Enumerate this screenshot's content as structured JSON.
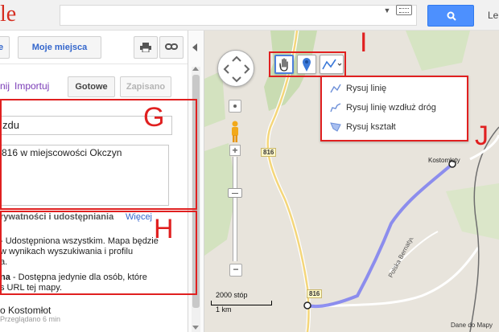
{
  "header": {
    "logo_fragment": "le",
    "search_value": "",
    "user_fragment": "Le"
  },
  "panel": {
    "toolbar": {
      "left_fragment": "e",
      "my_places": "Moje miejsca"
    },
    "links": {
      "fragment": "nij",
      "import": "Importuj"
    },
    "done_button": "Gotowe",
    "saved_button": "Zapisano",
    "title_value": "zdu",
    "description_value": "816 w miejscowości Okczyn",
    "privacy": {
      "heading": "rywatności i udostępniania",
      "more": "Więcej",
      "public_line1_bold": "",
      "public_line1": "- Udostępniona wszystkim. Mapa będzie",
      "public_line2": "w wynikach wyszukiwania i profilu",
      "public_line3": "a.",
      "unlisted_line1_bold": "na",
      "unlisted_line1": " - Dostępna jedynie dla osób, które",
      "unlisted_line2": "s URL tej mapy."
    },
    "place_title": "o Kostomłot",
    "place_meta": "Przeglądano 6 min"
  },
  "map": {
    "draw_menu": {
      "line": "Rysuj linię",
      "road_line": "Rysuj linię wzdłuż dróg",
      "shape": "Rysuj kształt"
    },
    "road_labels": [
      "816",
      "816"
    ],
    "place_label": "Kostomłoty",
    "street_label": "Polska Bernatycze",
    "scale": {
      "top": "2000 stóp",
      "bottom": "1 km"
    },
    "credit": "Dane do Mapy"
  },
  "annotations": {
    "g": "G",
    "h": "H",
    "i": "I",
    "j": "J"
  },
  "colors": {
    "accent_blue": "#4d90fe",
    "annotation_red": "#e02020",
    "route_blue": "#7b7ef0",
    "link_purple": "#7a3bb6"
  }
}
